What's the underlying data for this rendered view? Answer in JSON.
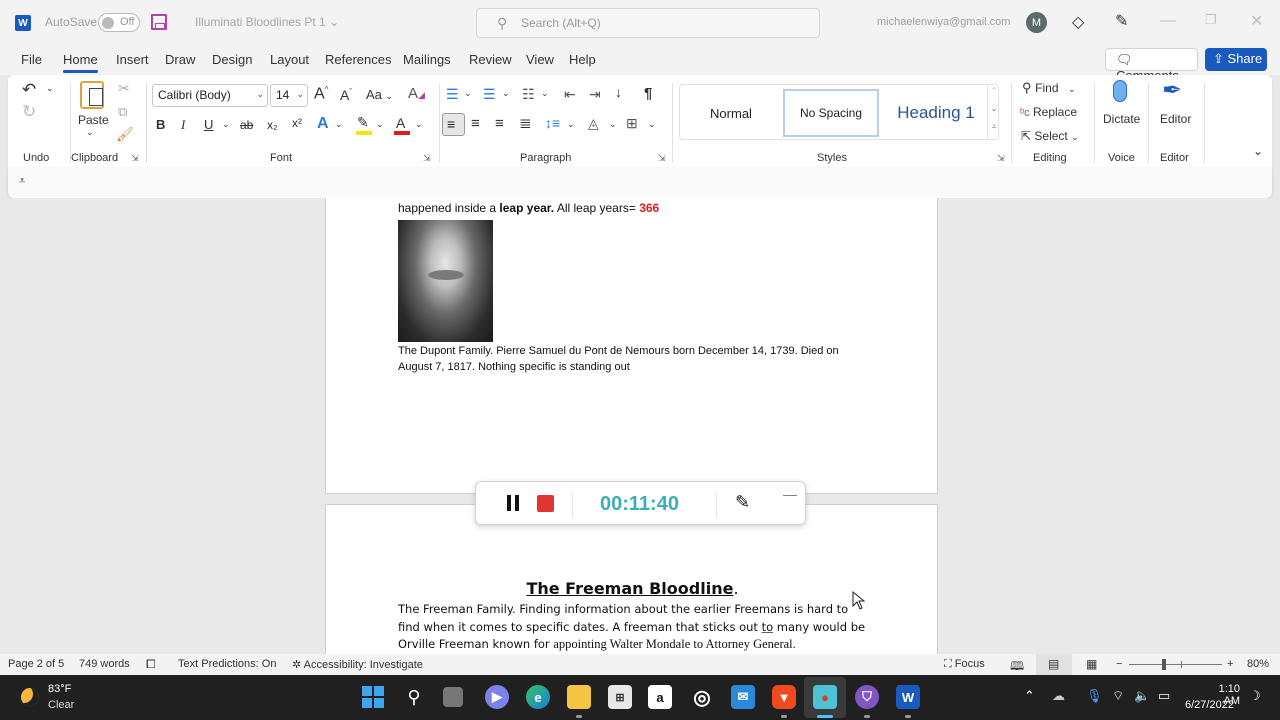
{
  "titlebar": {
    "app_icon": "word-icon",
    "autosave_label": "AutoSave",
    "autosave_state": "Off",
    "save_icon": "save-icon",
    "doc_title": "Illuminati Bloodlines Pt 1",
    "doc_title_chevron": "⌄",
    "search_placeholder": "Search (Alt+Q)",
    "account_email": "michaelenwiya@gmail.com",
    "avatar_initial": "M",
    "window_controls": {
      "minimize": "—",
      "maximize": "❐",
      "close": "✕"
    }
  },
  "menu": {
    "tabs": [
      "File",
      "Home",
      "Insert",
      "Draw",
      "Design",
      "Layout",
      "References",
      "Mailings",
      "Review",
      "View",
      "Help"
    ],
    "active_tab": "Home",
    "comments_label": "Comments",
    "share_label": "Share"
  },
  "ribbon": {
    "groups": {
      "undo": "Undo",
      "clipboard": "Clipboard",
      "font": "Font",
      "paragraph": "Paragraph",
      "styles": "Styles",
      "editing": "Editing",
      "voice": "Voice",
      "editor": "Editor"
    },
    "paste_label": "Paste",
    "font_name": "Calibri (Body)",
    "font_size": "14",
    "font_buttons": {
      "bold": "B",
      "italic": "I",
      "underline": "U",
      "strikethrough": "ab",
      "subscript": "x₂",
      "superscript": "x²",
      "grow": "A^",
      "shrink": "Aˇ",
      "case": "Aa"
    },
    "colors": {
      "highlight": "#f5e60a",
      "font_color": "#e01b1b",
      "accent": "#185abd"
    },
    "styles": [
      "Normal",
      "No Spacing",
      "Heading 1"
    ],
    "selected_style": "No Spacing",
    "editing": {
      "find": "Find",
      "replace": "Replace",
      "select": "Select"
    },
    "dictate_label": "Dictate",
    "editor_label": "Editor"
  },
  "document": {
    "page1": {
      "line_prefix": "happened inside a ",
      "line_bold": "leap year.",
      "line_mid": " All leap years= ",
      "line_red": "366",
      "image_alt": "Portrait of Pierre Samuel du Pont de Nemours",
      "caption": "The Dupont Family. Pierre Samuel du Pont de Nemours born December 14, 1739. Died on August 7, 1817. Nothing specific is standing out"
    },
    "page2": {
      "heading": "The Freeman Bloodline",
      "heading_suffix": ".",
      "para_1": "The Freeman Family. Finding information about the earlier Freemans is hard to find when it comes to specific dates. A freeman that sticks out ",
      "para_flagged": "to",
      "para_2": " many would be Orville Freeman known for ",
      "para_serif": "appointing Walter Mondale to Attorney General."
    }
  },
  "recorder": {
    "pause_icon": "pause-icon",
    "stop_icon": "stop-icon",
    "elapsed": "00:11:40",
    "pen_icon": "pen-icon",
    "minimize": "—"
  },
  "statusbar": {
    "page": "Page 2 of 5",
    "words": "749 words",
    "text_predictions": "Text Predictions: On",
    "accessibility": "Accessibility: Investigate",
    "focus": "Focus",
    "zoom_minus": "−",
    "zoom_plus": "+",
    "zoom_level": "80%",
    "zoom_fraction": 0.38
  },
  "taskbar": {
    "temperature": "83°F",
    "condition": "Clear",
    "apps": [
      "start",
      "search",
      "task-view",
      "teams-chat",
      "edge",
      "file-explorer",
      "store",
      "amazon",
      "app-circle",
      "mail",
      "brave",
      "screen-recorder",
      "vpn",
      "word"
    ],
    "time": "1:10 AM",
    "date": "6/27/2022"
  }
}
